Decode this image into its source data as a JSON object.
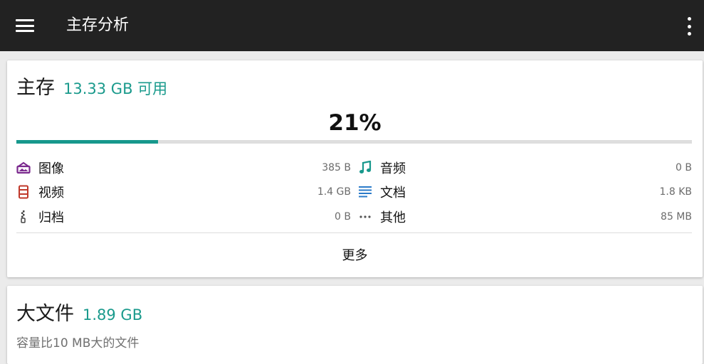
{
  "appbar": {
    "title": "主存分析"
  },
  "storage": {
    "title": "主存",
    "available": "13.33 GB 可用",
    "usage_percent_text": "21%",
    "usage_percent": 21,
    "accent_color": "#1a9a8c",
    "categories": [
      {
        "name": "图像",
        "size": "385 B",
        "icon": "image-icon"
      },
      {
        "name": "视频",
        "size": "1.4 GB",
        "icon": "video-icon"
      },
      {
        "name": "归档",
        "size": "0 B",
        "icon": "archive-icon"
      },
      {
        "name": "音频",
        "size": "0 B",
        "icon": "music-note-icon"
      },
      {
        "name": "文档",
        "size": "1.8 KB",
        "icon": "document-icon"
      },
      {
        "name": "其他",
        "size": "85 MB",
        "icon": "more-horizontal-icon"
      }
    ],
    "more_label": "更多"
  },
  "large_files": {
    "title": "大文件",
    "size": "1.89 GB",
    "description": "容量比10 MB大的文件"
  }
}
